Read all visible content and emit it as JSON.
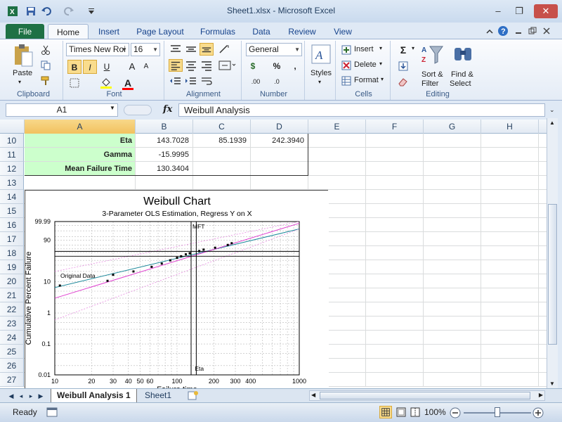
{
  "window": {
    "title": "Sheet1.xlsx  -  Microsoft Excel",
    "minimize": "–",
    "restore": "❐",
    "close": "✕"
  },
  "tabs": [
    "File",
    "Home",
    "Insert",
    "Page Layout",
    "Formulas",
    "Data",
    "Review",
    "View"
  ],
  "ribbon": {
    "clipboard": {
      "label": "Clipboard",
      "paste": "Paste"
    },
    "font": {
      "label": "Font",
      "font_name": "Times New Roi",
      "font_size": "16",
      "bold": "B",
      "italic": "I",
      "underline": "U",
      "grow": "A",
      "shrink": "A",
      "font_color": "A"
    },
    "alignment": {
      "label": "Alignment"
    },
    "number": {
      "label": "Number",
      "format": "General",
      "currency": "$",
      "percent": "%",
      "comma": ",",
      "inc_decimal": ".00",
      "dec_decimal": ".0"
    },
    "styles": {
      "label": "Styles"
    },
    "cells": {
      "label": "Cells",
      "insert": "Insert",
      "delete": "Delete",
      "format": "Format"
    },
    "editing": {
      "label": "Editing",
      "sum": "Σ",
      "sort": "Sort &",
      "filter": "Filter",
      "find": "Find &",
      "select": "Select"
    }
  },
  "formula_bar": {
    "name_box": "A1",
    "fx": "fx",
    "value": "Weibull Analysis"
  },
  "columns": [
    "A",
    "B",
    "C",
    "D",
    "E",
    "F",
    "G",
    "H"
  ],
  "rows": [
    "10",
    "11",
    "12",
    "13",
    "14",
    "15",
    "16",
    "17",
    "18",
    "19",
    "20",
    "21",
    "22",
    "23",
    "24",
    "25",
    "26",
    "27"
  ],
  "table": [
    {
      "label": "Eta",
      "b": "143.7028",
      "c": "85.1939",
      "d": "242.3940"
    },
    {
      "label": "Gamma",
      "b": "-15.9995",
      "c": "",
      "d": ""
    },
    {
      "label": "Mean Failure Time",
      "b": "130.3404",
      "c": "",
      "d": ""
    }
  ],
  "chart_data": {
    "type": "scatter",
    "title": "Weibull Chart",
    "subtitle": "3-Parameter OLS Estimation, Regress Y on X",
    "xlabel": "Failure time",
    "ylabel": "Cumulative Percent Failure",
    "x_scale": "log",
    "xlim": [
      10,
      1000
    ],
    "x_ticks": [
      "10",
      "20",
      "30",
      "40",
      "50",
      "60",
      "100",
      "200",
      "300",
      "400",
      "1000"
    ],
    "y_ticks": [
      "99.99",
      "90",
      "10",
      "1",
      "0.1",
      "0.01"
    ],
    "grid": true,
    "annotations": [
      "Original Data",
      "MFT",
      "Eta"
    ],
    "series": [
      {
        "name": "Original Data",
        "x": [
          11,
          27,
          30,
          44,
          62,
          75,
          88,
          100,
          108,
          118,
          127,
          152,
          165,
          205,
          260,
          280
        ],
        "y": [
          7.5,
          10.5,
          16,
          20,
          27,
          33,
          40,
          46,
          50,
          55,
          58,
          64,
          68,
          73,
          80,
          84
        ]
      }
    ],
    "mft": 130.34,
    "eta": 143.7
  },
  "sheets": [
    "Weibull Analysis 1",
    "Sheet1"
  ],
  "status": {
    "ready": "Ready",
    "zoom": "100%"
  }
}
